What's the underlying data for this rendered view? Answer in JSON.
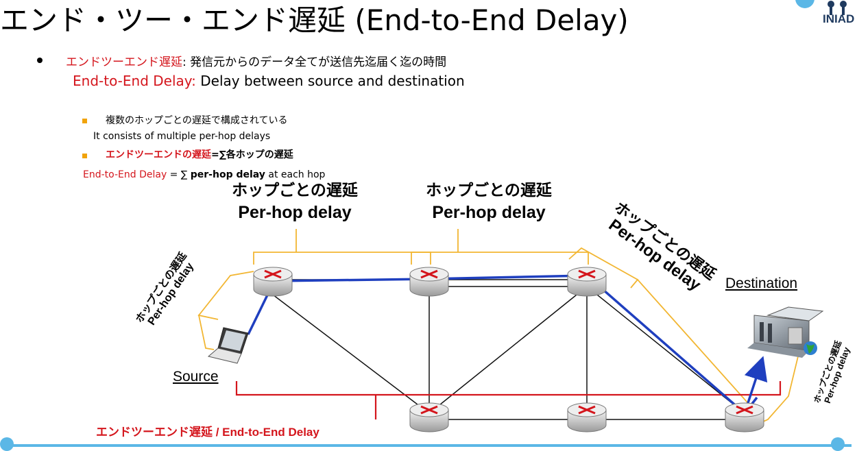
{
  "title": "エンド・ツー・エンド遅延 (End-to-End Delay)",
  "logo": {
    "text": "INIAD"
  },
  "bullets": {
    "b1_red": "エンドツーエンド遅延",
    "b1_rest": ": 発信元からのデータ全てが送信先迄届く迄の時間",
    "b1_en_red": "End-to-End Delay:",
    "b1_en_rest": " Delay between source and destination",
    "b2_jp": "複数のホップごとの遅延で構成されている",
    "b2_en": "It consists of multiple per-hop delays",
    "b3_red": "エンドツーエンドの遅延",
    "b3_rest": "=∑各ホップの遅延",
    "b3_en_red": "End-to-End Delay",
    "b3_en_mid": " = ∑ ",
    "b3_en_bold": "per-hop delay",
    "b3_en_rest": " at each hop"
  },
  "diagram": {
    "hop_jp": "ホップごとの遅延",
    "hop_en": "Per-hop delay",
    "source_label": "Source",
    "destination_label": "Destination",
    "ete_label": "エンドツーエンド遅延 / End-to-End Delay"
  },
  "colors": {
    "accent_red": "#d4151c",
    "path_blue": "#1f3fbf",
    "brace_yellow": "#f2b632",
    "footer_blue": "#5bb7e6"
  }
}
